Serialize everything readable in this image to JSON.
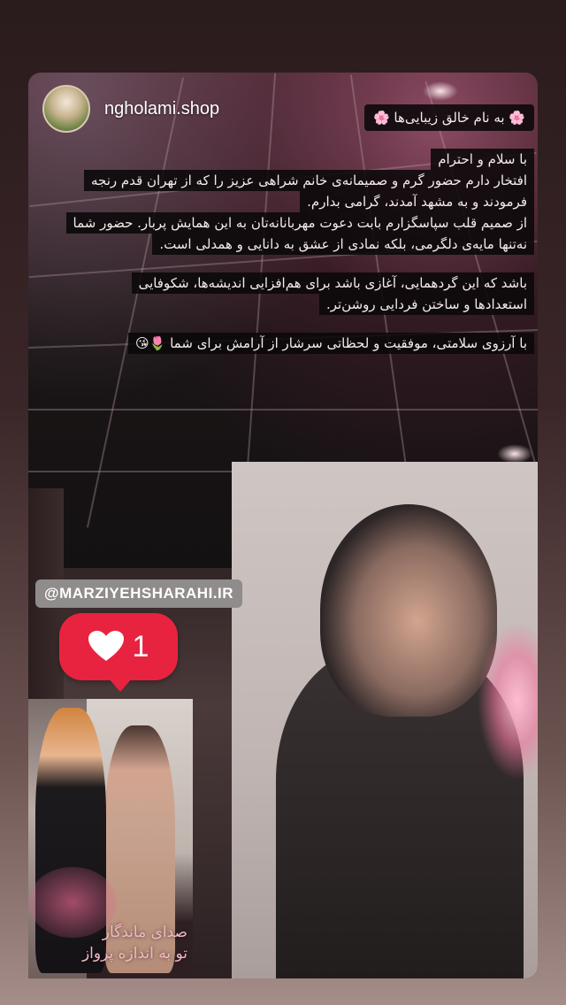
{
  "story": {
    "username": "ngholami.shop",
    "caption": {
      "title": "🌸 به نام خالق زیبایی‌ها 🌸",
      "lines": [
        "با سلام و احترام",
        "افتخار دارم حضور گرم و صمیمانه‌ی خانم شراهی عزیز را که از تهران قدم رنجه",
        "فرمودند و به مشهد آمدند، گرامی بدارم.",
        "از صمیم قلب سپاسگزارم بابت دعوت مهربانانه‌تان به این همایش پربار. حضور شما",
        "نه‌تنها مایه‌ی دلگرمی، بلکه نمادی از عشق به دانایی و همدلی است."
      ],
      "paragraph2": [
        "باشد که این گردهمایی، آغازی باشد برای هم‌افزایی اندیشه‌ها، شکوفایی",
        "استعدادها و ساختن فردایی روشن‌تر."
      ],
      "closing": "با آرزوی سلامتی، موفقیت و لحظاتی سرشار از آرامش برای شما 🌷😘"
    },
    "mention": "@MARZIYEHSHARAHI.IR",
    "like_sticker": {
      "count": "1",
      "color": "#e8233f",
      "icon": "heart-icon"
    },
    "inset_text": "صدای ماندگار\nتو به اندازه پرواز"
  }
}
